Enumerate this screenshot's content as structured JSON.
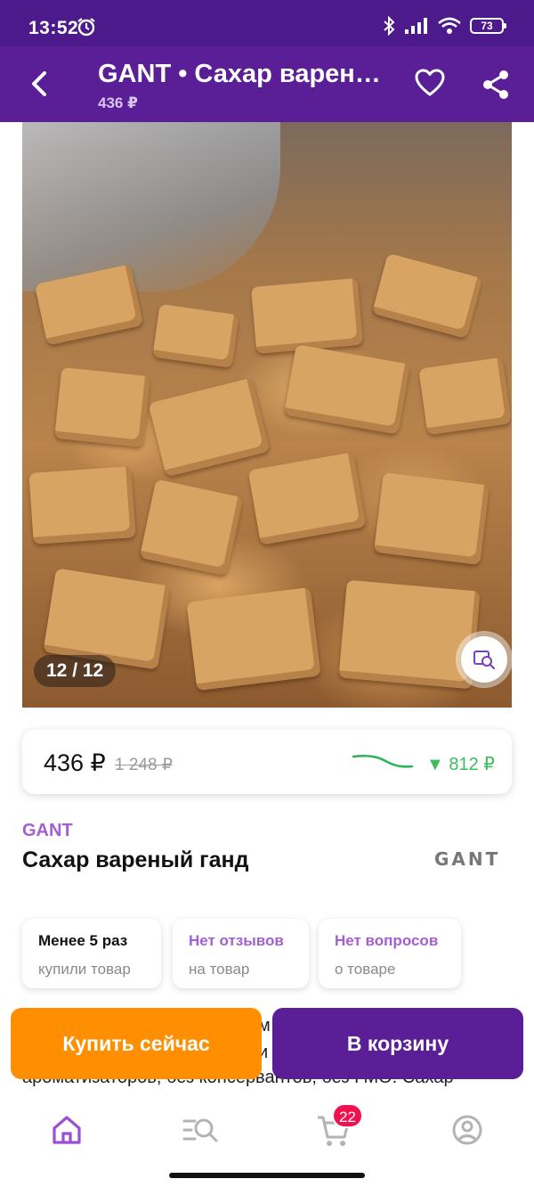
{
  "status_bar": {
    "time": "13:52",
    "battery": "73"
  },
  "app_bar": {
    "title": "GANT • Сахар варен…",
    "subtitle": "436 ₽"
  },
  "gallery": {
    "counter": "12 / 12"
  },
  "price": {
    "current": "436 ₽",
    "old": "1 248 ₽",
    "discount": "▼ 812 ₽",
    "discount_color": "#3cbc5c"
  },
  "product": {
    "brand": "GANT",
    "name": "Сахар вареный ганд",
    "brand_logo_text": "GANT"
  },
  "info_cards": [
    {
      "line1": "Менее 5 раз",
      "line2": "купили товар"
    },
    {
      "line1": "Нет отзывов",
      "line2": "на товар"
    },
    {
      "line1": "Нет вопросов",
      "line2": "о товаре"
    }
  ],
  "description": {
    "visible_line": "ароматизаторов, без консервантов, без ГМО.  Сахар",
    "peek_1": "м",
    "peek_2": "и"
  },
  "actions": {
    "buy_now": "Купить сейчас",
    "add_to_cart": "В корзину"
  },
  "bottom_nav": {
    "cart_badge": "22"
  },
  "colors": {
    "brand_purple": "#5a1e96",
    "accent_orange": "#ff8f00",
    "badge_red": "#f0114e",
    "brand_text": "#a35fd1"
  }
}
